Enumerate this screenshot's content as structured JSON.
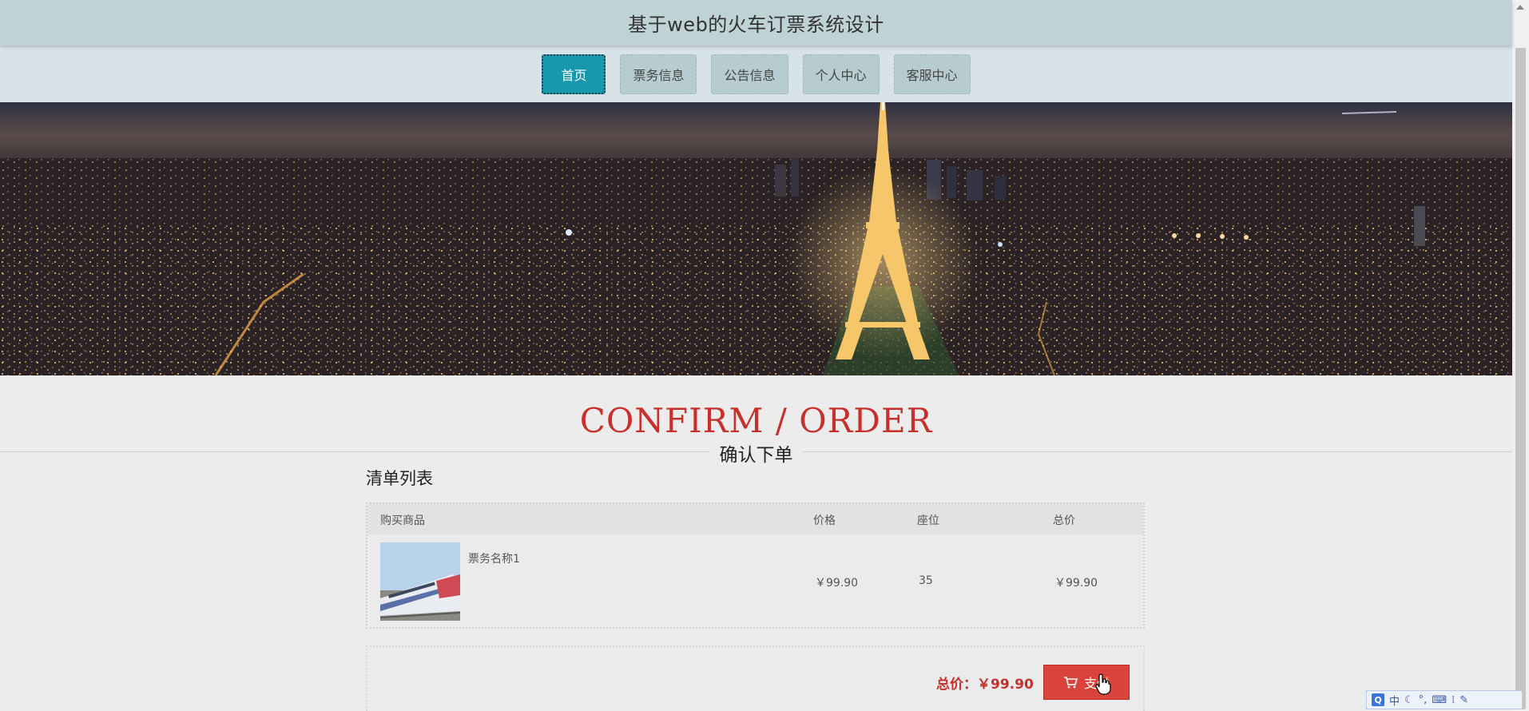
{
  "header": {
    "site_title": "基于web的火车订票系统设计"
  },
  "nav": {
    "items": [
      {
        "label": "首页",
        "active": true
      },
      {
        "label": "票务信息",
        "active": false
      },
      {
        "label": "公告信息",
        "active": false
      },
      {
        "label": "个人中心",
        "active": false
      },
      {
        "label": "客服中心",
        "active": false
      }
    ]
  },
  "section": {
    "title_en": "CONFIRM / ORDER",
    "title_cn": "确认下单",
    "list_title": "清单列表"
  },
  "cart": {
    "columns": [
      "购买商品",
      "价格",
      "座位",
      "总价"
    ],
    "rows": [
      {
        "name": "票务名称1",
        "price": "￥99.90",
        "seat": "35",
        "total": "￥99.90"
      }
    ]
  },
  "summary": {
    "total_label": "总价：￥99.90",
    "pay_label": "支付"
  },
  "ime": {
    "mode": "中"
  },
  "colors": {
    "accent_red": "#c8302b",
    "nav_active": "#1898ad",
    "pay_button": "#d9433b",
    "header_bg": "#bfd2d6"
  }
}
